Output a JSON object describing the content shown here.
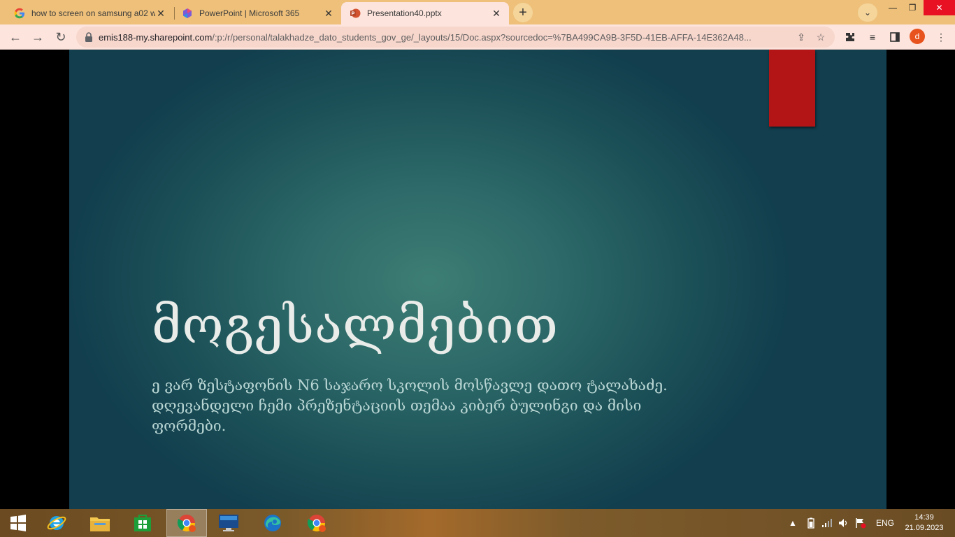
{
  "browser": {
    "tabs": [
      {
        "title": "how to screen on samsung a02 w",
        "icon": "google-g-icon",
        "active": false
      },
      {
        "title": "PowerPoint | Microsoft 365",
        "icon": "microsoft365-icon",
        "active": false
      },
      {
        "title": "Presentation40.pptx",
        "icon": "powerpoint-icon",
        "active": true
      }
    ],
    "new_tab_label": "+",
    "url_host": "emis188-my.sharepoint.com",
    "url_rest": "/:p:/r/personal/talakhadze_dato_students_gov_ge/_layouts/15/Doc.aspx?sourcedoc=%7BA499CA9B-3F5D-41EB-AFFA-14E362A48...",
    "profile_initial": "d"
  },
  "slide": {
    "title": "მოგესალმებით",
    "subtitle": " ე ვარ ზესტაფონის N6 საჯარო სკოლის მოსწავლე დათო ტალახაძე.\nდღევანდელი ჩემი პრეზენტაციის თემაა კიბერ ბულინგი და მისი\nფორმები.",
    "accent_color": "#b31516"
  },
  "taskbar": {
    "apps": [
      "start-windows-icon",
      "internet-explorer-icon",
      "file-explorer-icon",
      "microsoft-store-icon",
      "chrome-icon",
      "lenovo-icon",
      "edge-icon",
      "chrome-profile-icon"
    ],
    "language": "ENG",
    "time": "14:39",
    "date": "21.09.2023"
  }
}
